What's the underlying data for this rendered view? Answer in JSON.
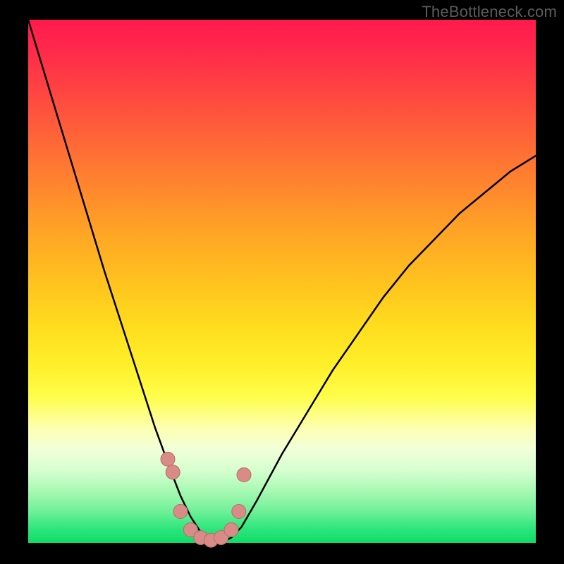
{
  "watermark": "TheBottleneck.com",
  "colors": {
    "gradient_top": "#ff1a4d",
    "gradient_mid": "#ffde1e",
    "gradient_bottom": "#0ddc68",
    "curve": "#000000",
    "marker_fill": "#d98b87",
    "marker_stroke": "#b86b66",
    "frame": "#000000"
  },
  "chart_data": {
    "type": "line",
    "title": "",
    "xlabel": "",
    "ylabel": "",
    "xlim": [
      0,
      100
    ],
    "ylim": [
      0,
      100
    ],
    "grid": false,
    "legend": "none",
    "series": [
      {
        "name": "bottleneck-curve",
        "x": [
          0,
          5,
          10,
          15,
          20,
          25,
          28,
          30,
          32,
          34,
          36,
          38,
          40,
          42,
          45,
          50,
          55,
          60,
          65,
          70,
          75,
          80,
          85,
          90,
          95,
          100
        ],
        "y": [
          100,
          84,
          68,
          52,
          37,
          22,
          14,
          9,
          5,
          2,
          0,
          0,
          1,
          3,
          8,
          17,
          25,
          33,
          40,
          47,
          53,
          58,
          63,
          67,
          71,
          74
        ]
      }
    ],
    "markers": {
      "x": [
        27.5,
        28.5,
        30,
        32,
        34,
        36,
        38,
        40,
        41.5,
        42.5
      ],
      "y": [
        16,
        13.5,
        6,
        2.5,
        1,
        0.5,
        1,
        2.5,
        6,
        13
      ]
    },
    "notes": "Axes are unlabeled in the source image; values are estimated on a 0–100 normalized scale from the plotted pixels. y=100 corresponds to top of chart (red region), y=0 corresponds to bottom (green region)."
  }
}
